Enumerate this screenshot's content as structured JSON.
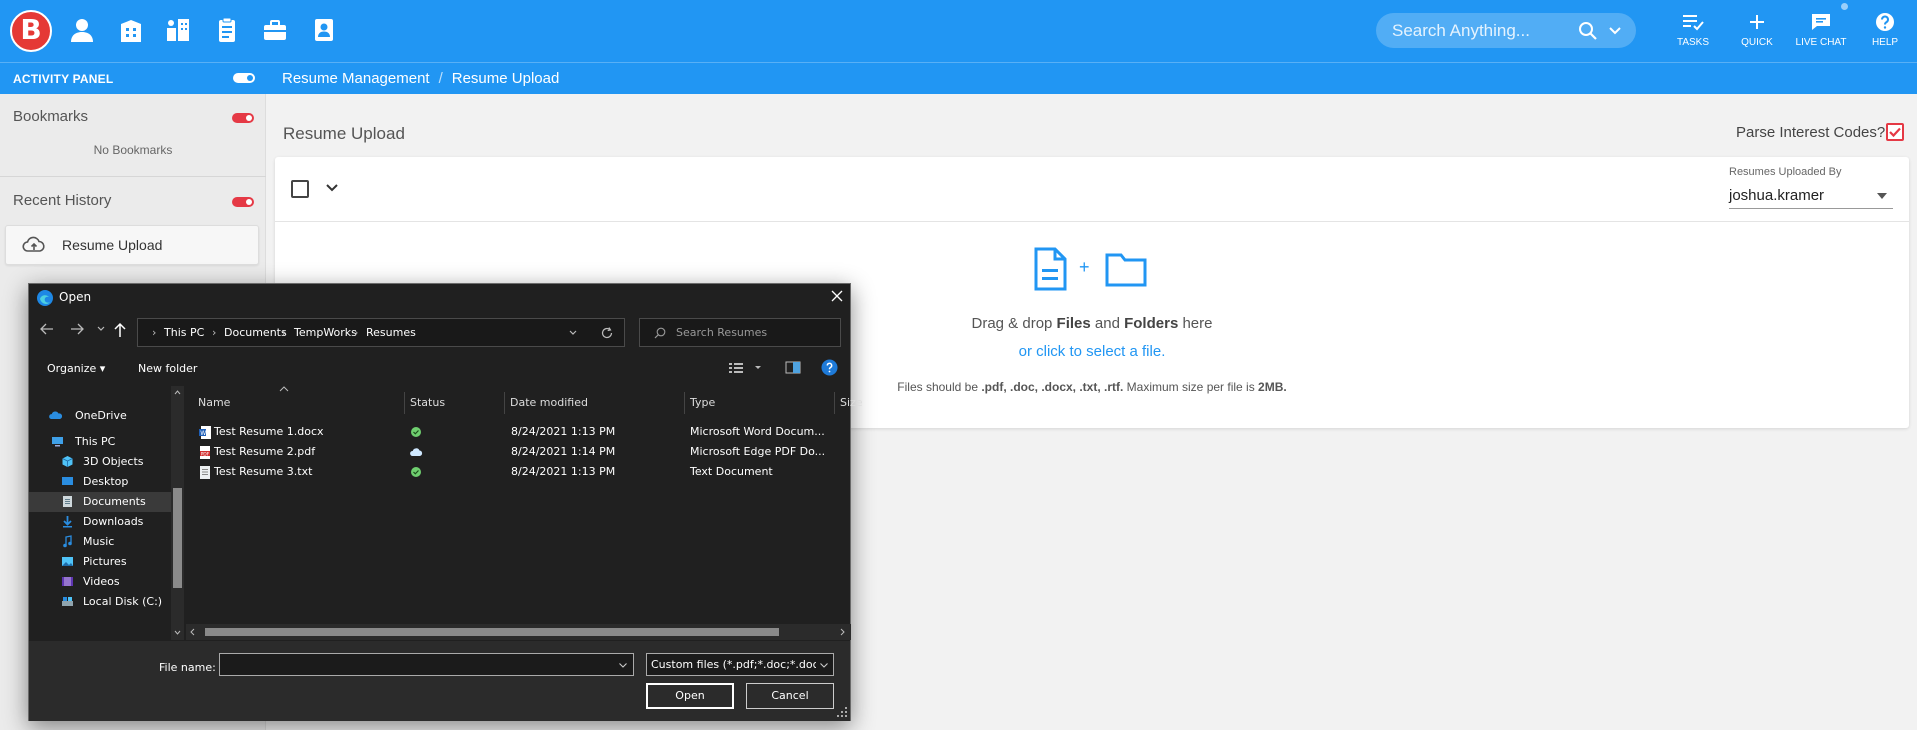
{
  "app": {
    "logo_letter": "B",
    "brand_color": "#2196f3",
    "accent_red": "#e53945",
    "nav_icons": [
      "person-icon",
      "building-icon",
      "org-chart-icon",
      "clipboard-icon",
      "briefcase-icon",
      "id-badge-icon"
    ]
  },
  "header": {
    "search_placeholder": "Search Anything...",
    "actions": [
      {
        "label": "TASKS",
        "icon": "tasks-icon"
      },
      {
        "label": "QUICK",
        "icon": "plus-icon"
      },
      {
        "label": "LIVE CHAT",
        "icon": "chat-icon"
      },
      {
        "label": "HELP",
        "icon": "help-icon"
      }
    ]
  },
  "subbar": {
    "activity_panel": "ACTIVITY PANEL",
    "breadcrumbs": [
      "Resume Management",
      "Resume Upload"
    ]
  },
  "sidebar": {
    "bookmarks_title": "Bookmarks",
    "no_bookmarks": "No Bookmarks",
    "recent_history_title": "Recent History",
    "history_items": [
      {
        "label": "Resume Upload",
        "icon": "cloud-upload-icon"
      }
    ]
  },
  "main": {
    "title": "Resume Upload",
    "parse_label": "Parse Interest Codes?",
    "parse_checked": true,
    "uploaded_by_label": "Resumes Uploaded By",
    "uploaded_by_value": "joshua.kramer",
    "drop_plus": "+",
    "drop_prefix": "Drag & drop ",
    "drop_files": "Files",
    "drop_and": " and ",
    "drop_folders": "Folders",
    "drop_suffix": " here",
    "drop_link": "or click to select a file.",
    "note_prefix": "Files should be ",
    "note_types": ".pdf, .doc, .docx, .txt, .rtf.",
    "note_middle": " Maximum size per file is ",
    "note_size": "2MB."
  },
  "dialog": {
    "title": "Open",
    "path": [
      "This PC",
      "Documents",
      "TempWorks",
      "Resumes"
    ],
    "search_placeholder": "Search Resumes",
    "organize": "Organize ▾",
    "new_folder": "New folder",
    "nav_items": [
      {
        "label": "OneDrive",
        "icon": "onedrive-icon"
      },
      {
        "label": "This PC",
        "icon": "computer-icon"
      },
      {
        "label": "3D Objects",
        "icon": "cube-icon"
      },
      {
        "label": "Desktop",
        "icon": "desktop-icon"
      },
      {
        "label": "Documents",
        "icon": "documents-icon",
        "selected": true
      },
      {
        "label": "Downloads",
        "icon": "download-icon"
      },
      {
        "label": "Music",
        "icon": "music-icon"
      },
      {
        "label": "Pictures",
        "icon": "pictures-icon"
      },
      {
        "label": "Videos",
        "icon": "video-icon"
      },
      {
        "label": "Local Disk (C:)",
        "icon": "disk-icon"
      }
    ],
    "columns": [
      "Name",
      "Status",
      "Date modified",
      "Type",
      "Size"
    ],
    "files": [
      {
        "name": "Test Resume 1.docx",
        "status": "synced",
        "date": "8/24/2021 1:13 PM",
        "type": "Microsoft Word Docum...",
        "icon": "word-file-icon"
      },
      {
        "name": "Test Resume 2.pdf",
        "status": "cloud",
        "date": "8/24/2021 1:14 PM",
        "type": "Microsoft Edge PDF Do...",
        "icon": "pdf-file-icon"
      },
      {
        "name": "Test Resume 3.txt",
        "status": "synced",
        "date": "8/24/2021 1:13 PM",
        "type": "Text Document",
        "icon": "text-file-icon"
      }
    ],
    "file_name_label": "File name:",
    "file_name_value": "",
    "filter": "Custom files (*.pdf;*.doc;*.docx",
    "open_label": "Open",
    "cancel_label": "Cancel"
  }
}
